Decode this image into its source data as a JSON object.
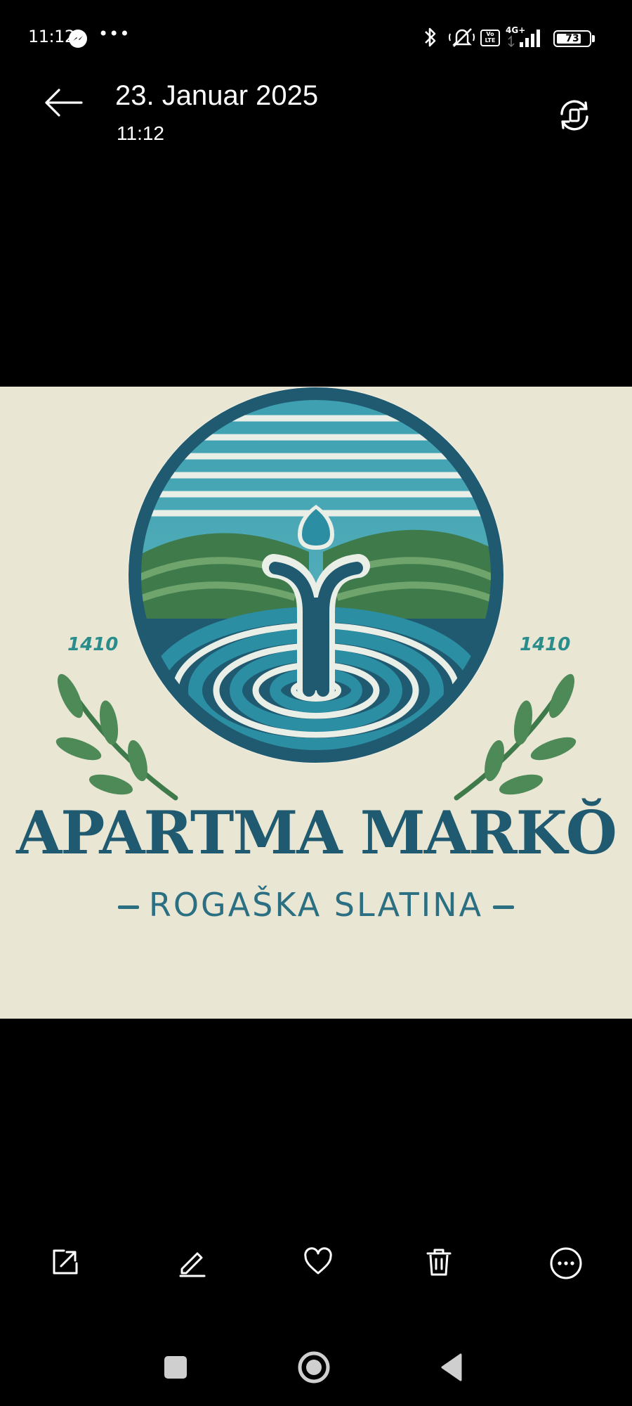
{
  "status_bar": {
    "time": "11:12",
    "more_dots": "•••",
    "network_badge_top": "Vo",
    "network_badge_bottom": "LTE",
    "network_type": "4G+",
    "battery_level": "73"
  },
  "header": {
    "date": "23. Januar 2025",
    "time": "11:12"
  },
  "photo": {
    "logo_title": "APARTMA MARKŎ",
    "logo_subtitle": "ROGAŠKA SLATINA",
    "year_left": "1410",
    "year_right": "1410",
    "colors": {
      "background": "#e9e6d4",
      "teal": "#2b8ea3",
      "navy": "#1f5a70",
      "green": "#3f7a4b"
    }
  },
  "bottom_actions": [
    {
      "icon": "share-icon"
    },
    {
      "icon": "edit-icon"
    },
    {
      "icon": "heart-icon"
    },
    {
      "icon": "delete-icon"
    },
    {
      "icon": "more-icon"
    }
  ],
  "nav_bar": [
    {
      "icon": "recents-square-icon"
    },
    {
      "icon": "home-circle-icon"
    },
    {
      "icon": "back-triangle-icon"
    }
  ]
}
